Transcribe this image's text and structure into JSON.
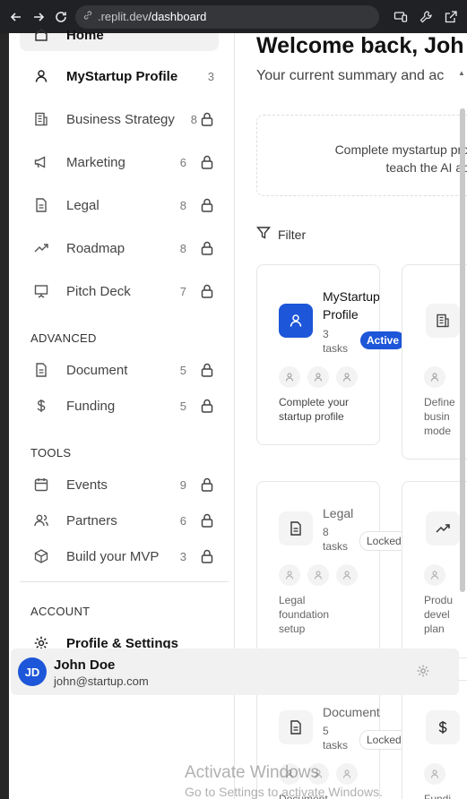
{
  "browser": {
    "url_host": ".replit.dev",
    "url_path": "/dashboard"
  },
  "sidebar": {
    "home_label": "Home",
    "items": [
      {
        "label": "MyStartup Profile",
        "count": "3",
        "icon": "user-icon",
        "locked": false,
        "active": true
      },
      {
        "label": "Business Strategy",
        "count": "8",
        "icon": "building-icon",
        "locked": true
      },
      {
        "label": "Marketing",
        "count": "6",
        "icon": "megaphone-icon",
        "locked": true
      },
      {
        "label": "Legal",
        "count": "8",
        "icon": "document-icon",
        "locked": true
      },
      {
        "label": "Roadmap",
        "count": "8",
        "icon": "trending-up-icon",
        "locked": true
      },
      {
        "label": "Pitch Deck",
        "count": "7",
        "icon": "presentation-icon",
        "locked": true
      }
    ],
    "advanced_heading": "ADVANCED",
    "advanced": [
      {
        "label": "Document",
        "count": "5",
        "icon": "document-icon",
        "locked": true
      },
      {
        "label": "Funding",
        "count": "5",
        "icon": "dollar-icon",
        "locked": true
      }
    ],
    "tools_heading": "TOOLS",
    "tools": [
      {
        "label": "Events",
        "count": "9",
        "icon": "calendar-icon",
        "locked": true
      },
      {
        "label": "Partners",
        "count": "6",
        "icon": "users-icon",
        "locked": true
      },
      {
        "label": "Build your MVP",
        "count": "3",
        "icon": "box-icon",
        "locked": true
      }
    ],
    "account_heading": "ACCOUNT",
    "settings_label": "Profile & Settings",
    "user": {
      "initials": "JD",
      "name": "John Doe",
      "email": "john@startup.com"
    }
  },
  "main": {
    "welcome": "Welcome back, Joh",
    "subtitle": "Your current summary and ac",
    "notice_line1": "Complete mystartup profile to",
    "notice_line2": "teach the AI abou",
    "filter_label": "Filter",
    "cards": [
      {
        "title_line1": "MyStartup",
        "title_line2": "Profile",
        "tasks_line1": "3",
        "tasks_line2": "tasks",
        "badge": "Active",
        "desc_line1": "Complete your",
        "desc_line2": "startup profile",
        "desc_line3": ""
      },
      {
        "desc_line1": "Define",
        "desc_line2": "busin",
        "desc_line3": "mode"
      },
      {
        "title_line1": "Legal",
        "tasks_line1": "8",
        "tasks_line2": "tasks",
        "badge": "Locked",
        "desc_line1": "Legal",
        "desc_line2": "foundation",
        "desc_line3": "setup"
      },
      {
        "desc_line1": "Produ",
        "desc_line2": "devel",
        "desc_line3": "plan"
      },
      {
        "title_line1": "Document",
        "tasks_line1": "5",
        "tasks_line2": "tasks",
        "badge": "Locked",
        "desc_line1": "Document"
      },
      {
        "desc_line1": "Fundi"
      }
    ]
  },
  "watermark": {
    "line1": "Activate Windows",
    "line2": "Go to Settings to activate Windows."
  },
  "colors": {
    "accent": "#1d56d8",
    "sidebar_active_bg": "#f1f1f1",
    "chrome_bg": "#202124"
  }
}
